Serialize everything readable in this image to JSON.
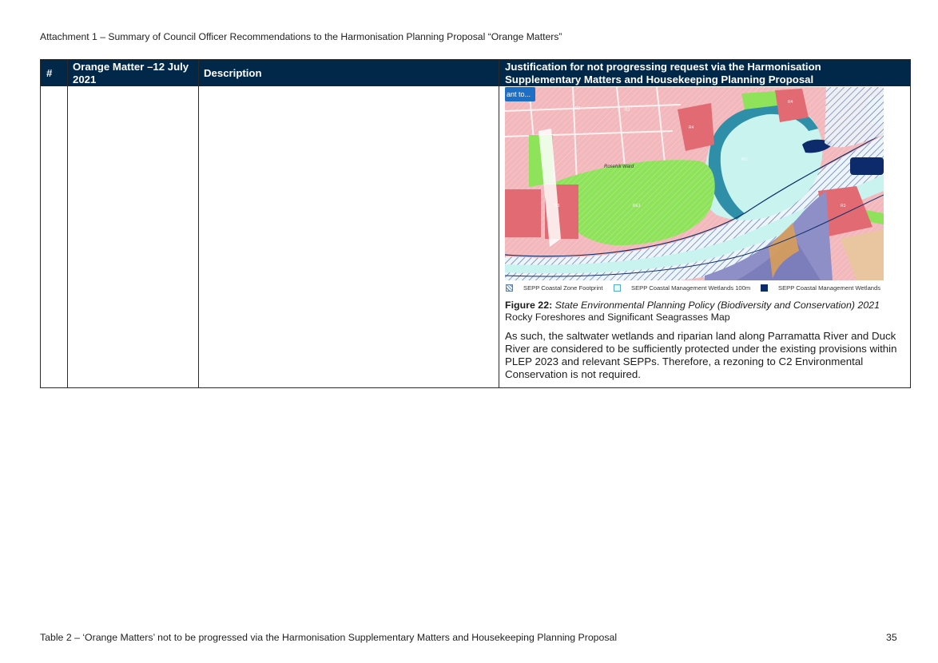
{
  "header": {
    "text": "Attachment 1 – Summary of Council Officer Recommendations to the Harmonisation Planning Proposal “Orange Matters”"
  },
  "table": {
    "columns": [
      "#",
      "Orange Matter –12 July 2021",
      "Description",
      "Justification for not progressing request via the Harmonisation Supplementary Matters and Housekeeping Planning Proposal"
    ],
    "row": {
      "figure": {
        "map_button_label": "ant to...",
        "map_area_label": "Rosehill Ward",
        "legend": [
          {
            "label": "SEPP Coastal Zone Footprint",
            "swatch": "hatched"
          },
          {
            "label": "SEPP Coastal Management Wetlands 100m",
            "swatch": "light"
          },
          {
            "label": "SEPP Coastal Management Wetlands",
            "swatch": "dark"
          }
        ],
        "colors": {
          "residential": "#f2b8bc",
          "residential_dense": "#e26b73",
          "recreation": "#8ee35a",
          "wetland_buffer": "#c9f3ef",
          "wetland_core": "#2f8fa8",
          "industrial": "#8e8fc7",
          "special_use": "#e9c6a0",
          "coastal_dark": "#0d2b6b"
        },
        "caption_label": "Figure 22:",
        "caption_title": "State Environmental Planning Policy (Biodiversity and Conservation) 2021",
        "caption_subtitle": "Rocky Foreshores and Significant Seagrasses Map"
      },
      "paragraph": "As such, the saltwater wetlands and riparian land along Parramatta River and Duck River are considered to be sufficiently protected under the existing provisions within PLEP 2023 and relevant SEPPs. Therefore, a rezoning to C2 Environmental Conservation is not required."
    }
  },
  "footer": {
    "caption": "Table 2 – ‘Orange Matters’ not to be progressed via the Harmonisation Supplementary Matters and Housekeeping Planning Proposal",
    "page_number": "35"
  }
}
